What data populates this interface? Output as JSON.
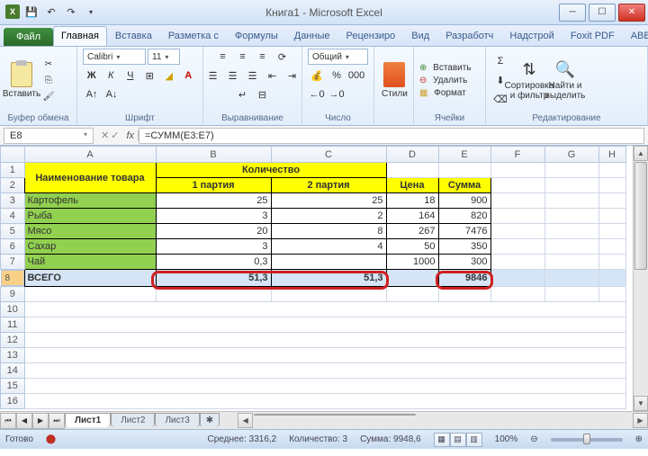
{
  "title": "Книга1 - Microsoft Excel",
  "file_tab": "Файл",
  "tabs": [
    "Главная",
    "Вставка",
    "Разметка с",
    "Формулы",
    "Данные",
    "Рецензиро",
    "Вид",
    "Разработч",
    "Надстрой",
    "Foxit PDF",
    "ABBYY PDF"
  ],
  "active_tab": 0,
  "clipboard": {
    "paste": "Вставить",
    "label": "Буфер обмена"
  },
  "font": {
    "name": "Calibri",
    "size": "11",
    "label": "Шрифт"
  },
  "align": {
    "label": "Выравнивание"
  },
  "number": {
    "format": "Общий",
    "label": "Число"
  },
  "styles": {
    "btn": "Стили"
  },
  "cells": {
    "insert": "Вставить",
    "delete": "Удалить",
    "format": "Формат",
    "label": "Ячейки"
  },
  "editing": {
    "sort": "Сортировка\nи фильтр",
    "find": "Найти и\nвыделить",
    "label": "Редактирование"
  },
  "namebox": "E8",
  "formula": "=СУММ(E3:E7)",
  "cols": [
    "A",
    "B",
    "C",
    "D",
    "E",
    "F",
    "G",
    "H"
  ],
  "headers": {
    "qty": "Количество",
    "name": "Наименование товара",
    "p1": "1 партия",
    "p2": "2 партия",
    "price": "Цена",
    "sum": "Сумма"
  },
  "rows": [
    {
      "n": "Картофель",
      "p1": "25",
      "p2": "25",
      "price": "18",
      "sum": "900"
    },
    {
      "n": "Рыба",
      "p1": "3",
      "p2": "2",
      "price": "164",
      "sum": "820"
    },
    {
      "n": "Мясо",
      "p1": "20",
      "p2": "8",
      "price": "267",
      "sum": "7476"
    },
    {
      "n": "Сахар",
      "p1": "3",
      "p2": "4",
      "price": "50",
      "sum": "350"
    },
    {
      "n": "Чай",
      "p1": "0,3",
      "p2": "",
      "price": "1000",
      "sum": "300"
    }
  ],
  "total": {
    "label": "ВСЕГО",
    "p1": "51,3",
    "p2": "51,3",
    "sum": "9846"
  },
  "sheets": [
    "Лист1",
    "Лист2",
    "Лист3"
  ],
  "status": {
    "ready": "Готово",
    "avg": "Среднее: 3316,2",
    "count": "Количество: 3",
    "sum": "Сумма: 9948,6",
    "zoom": "100%"
  }
}
